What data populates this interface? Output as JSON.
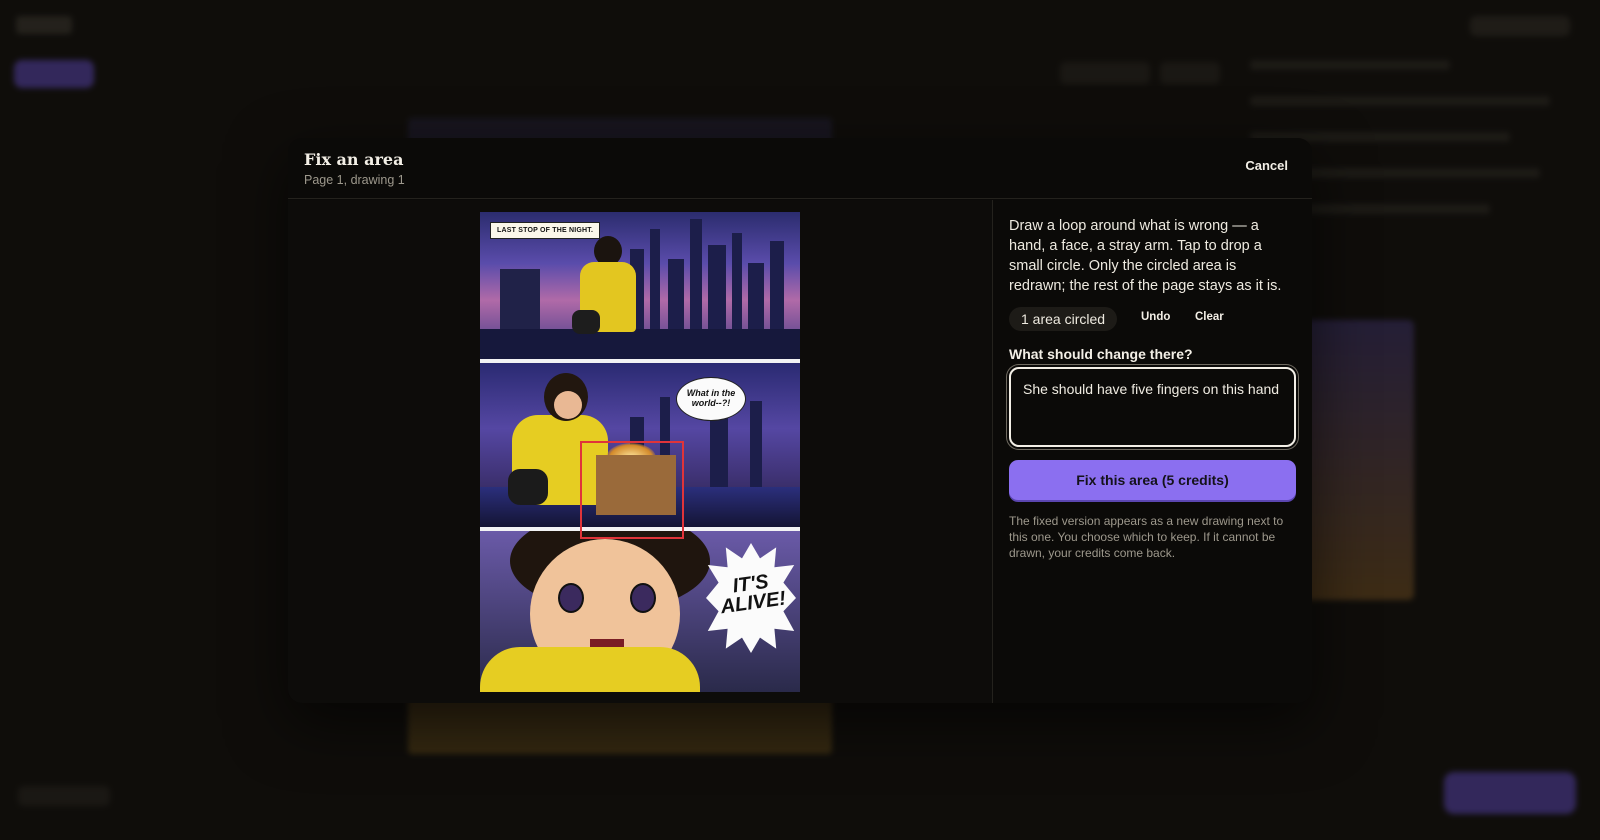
{
  "modal": {
    "title": "Fix an area",
    "subtitle": "Page 1, drawing 1",
    "cancel_label": "Cancel"
  },
  "comic": {
    "caption": "LAST STOP OF THE NIGHT.",
    "speech_bubble": "What in the world--?!",
    "burst_text": "IT'S ALIVE!"
  },
  "panel": {
    "instructions": "Draw a loop around what is wrong — a hand, a face, a stray arm. Tap to drop a small circle. Only the circled area is redrawn; the rest of the page stays as it is.",
    "circled_count": "1 area circled",
    "undo_label": "Undo",
    "clear_label": "Clear",
    "field_label": "What should change there?",
    "field_value": "She should have five fingers on this hand",
    "fix_button": "Fix this area (5 credits)",
    "footnote": "The fixed version appears as a new drawing next to this one. You choose which to keep. If it cannot be drawn, your credits come back."
  },
  "colors": {
    "accent": "#8b6ff0",
    "selection": "#e0343a",
    "modal_bg": "#0b0a08"
  }
}
